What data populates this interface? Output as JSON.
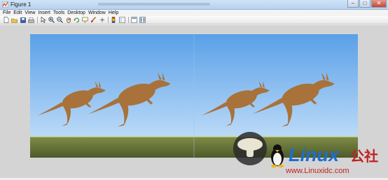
{
  "window": {
    "title": "Figure 1",
    "buttons": {
      "minimize": "–",
      "maximize": "□",
      "close": "✕"
    }
  },
  "menu": [
    "File",
    "Edit",
    "View",
    "Insert",
    "Tools",
    "Desktop",
    "Window",
    "Help"
  ],
  "toolbar": {
    "icons": [
      "new-figure-icon",
      "open-icon",
      "save-icon",
      "print-icon",
      "edit-plot-arrow-icon",
      "zoom-in-icon",
      "zoom-out-icon",
      "pan-hand-icon",
      "rotate-3d-icon",
      "data-cursor-icon",
      "brush-icon",
      "link-plot-icon",
      "insert-colorbar-icon",
      "insert-legend-icon",
      "hide-plot-tools-icon",
      "show-plot-tools-icon"
    ]
  },
  "figure": {
    "image": "two side-by-side identical photos of two kangaroos leaping over grassland under blue sky",
    "sky_top": "#5aa0e8",
    "sky_bottom": "#cfe6fb",
    "grass": "#6d7a3a",
    "kangaroo": "#a8723a"
  },
  "watermark": {
    "brand": "Linux",
    "cjk": "公社",
    "url": "www.Linuxidc.com"
  }
}
